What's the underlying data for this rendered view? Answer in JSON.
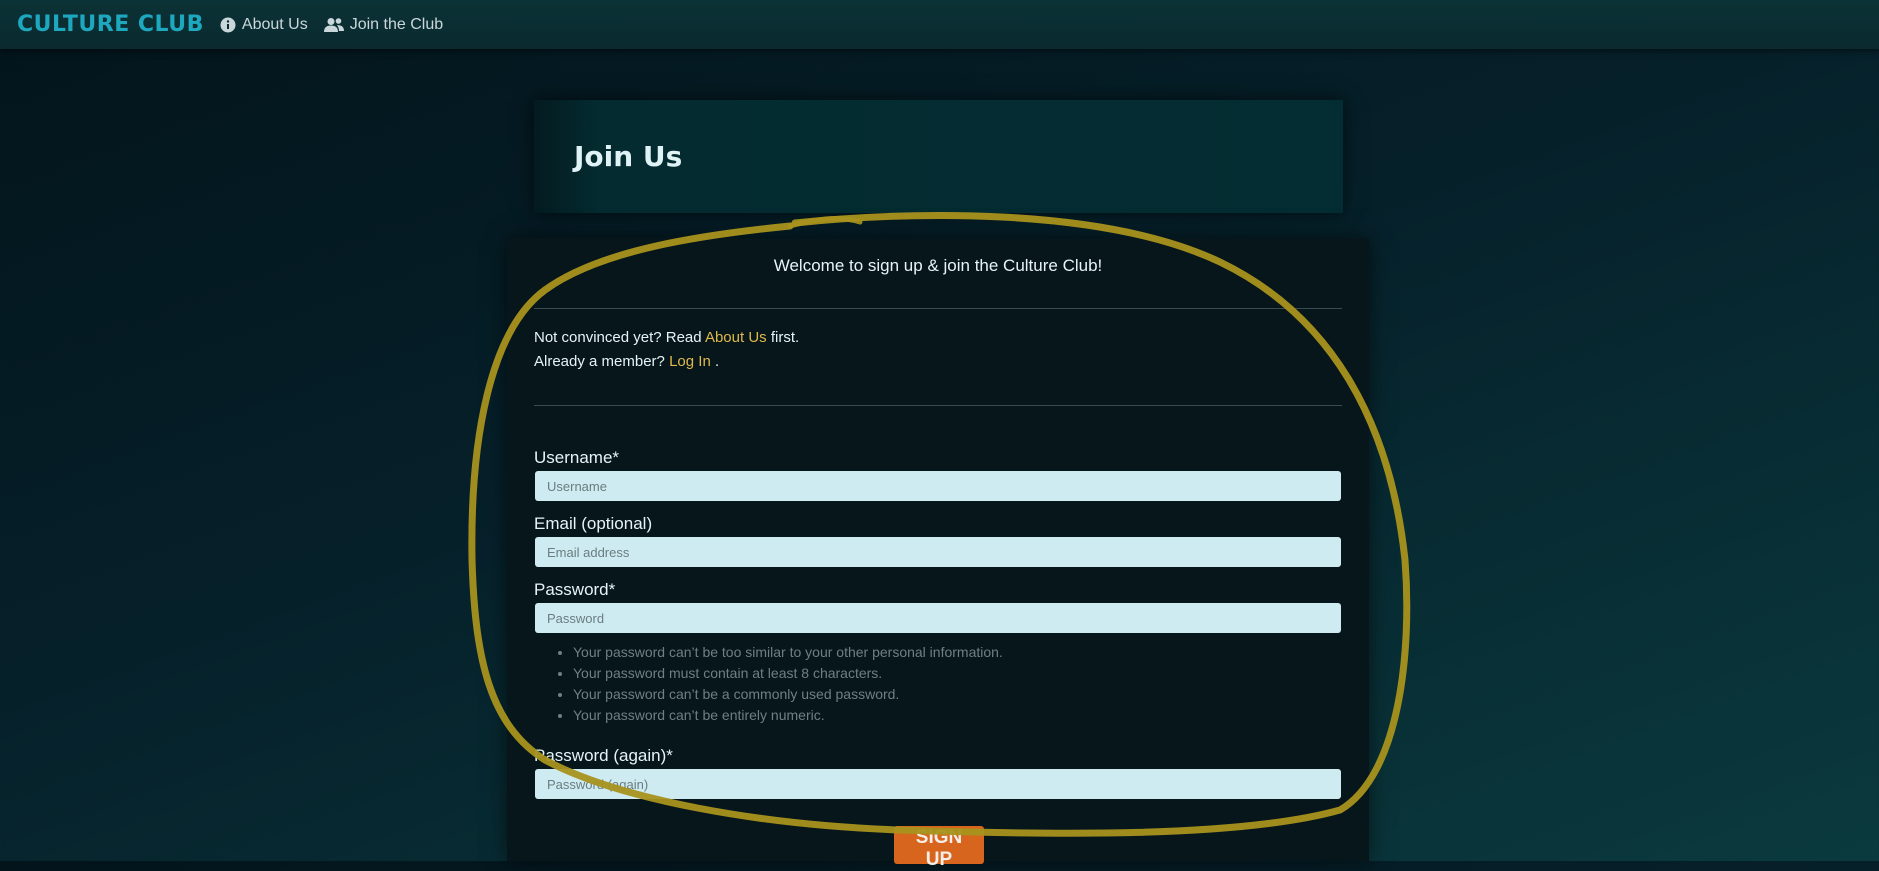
{
  "navbar": {
    "brand": "CULTURE CLUB",
    "links": [
      {
        "label": "About Us",
        "icon": "info-circle-icon"
      },
      {
        "label": "Join the Club",
        "icon": "users-icon"
      }
    ]
  },
  "hero": {
    "title": "Join Us"
  },
  "signup_card": {
    "welcome": "Welcome to sign up & join the Culture Club!",
    "intro_1": {
      "before": "Not convinced yet? Read",
      "link": "About Us",
      "after": "first."
    },
    "intro_2": {
      "before": "Already a member?",
      "link": "Log In",
      "after": "."
    },
    "fields": {
      "username": {
        "label": "Username*",
        "placeholder": "Username"
      },
      "email": {
        "label": "Email (optional)",
        "placeholder": "Email address"
      },
      "password": {
        "label": "Password*",
        "placeholder": "Password"
      },
      "password2": {
        "label": "Password (again)*",
        "placeholder": "Password (again)"
      }
    },
    "password_help": [
      "Your password can’t be too similar to your other personal information.",
      "Your password must contain at least 8 characters.",
      "Your password can’t be a commonly used password.",
      "Your password can’t be entirely numeric."
    ],
    "submit_label": "SIGN UP"
  },
  "colors": {
    "brand": "#1ea8c0",
    "link_gold": "#e0b94a",
    "button": "#d8651d",
    "input_bg": "#cdebf1",
    "annotation": "#a8921e"
  }
}
